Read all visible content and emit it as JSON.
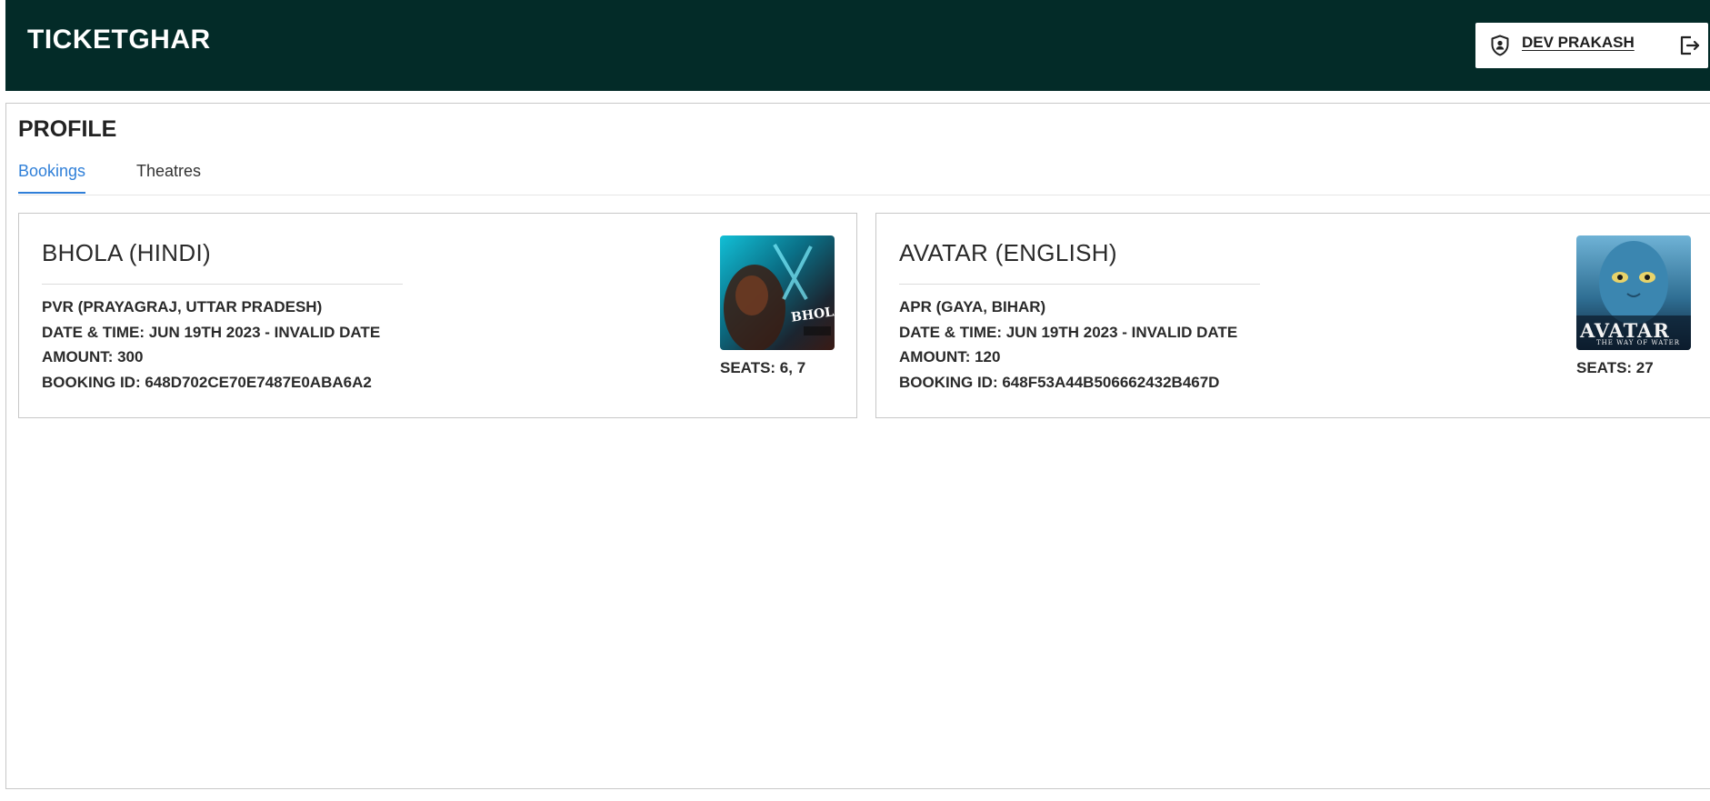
{
  "app": {
    "brand": "TICKETGHAR",
    "user_name": "DEV PRAKASH",
    "icons": {
      "user": "shield-user-icon",
      "logout": "logout-icon"
    },
    "colors": {
      "header_bg": "#032b28",
      "tab_active": "#2f7fd8"
    }
  },
  "page": {
    "title": "PROFILE",
    "tabs": [
      {
        "label": "Bookings",
        "active": true
      },
      {
        "label": "Theatres",
        "active": false
      }
    ]
  },
  "bookings": [
    {
      "movie": "BHOLA (HINDI)",
      "theatre": "PVR (PRAYAGRAJ, UTTAR PRADESH)",
      "datetime": "DATE & TIME: JUN 19TH 2023 - INVALID DATE",
      "amount": "AMOUNT: 300",
      "booking_id": "BOOKING ID: 648D702CE70E7487E0ABA6A2",
      "seats": "SEATS: 6, 7",
      "poster_text": "BHOLAA"
    },
    {
      "movie": "AVATAR (ENGLISH)",
      "theatre": "APR (GAYA, BIHAR)",
      "datetime": "DATE & TIME: JUN 19TH 2023 - INVALID DATE",
      "amount": "AMOUNT: 120",
      "booking_id": "BOOKING ID: 648F53A44B506662432B467D",
      "seats": "SEATS: 27",
      "poster_text": "AVATAR",
      "poster_subtext": "THE WAY OF WATER"
    }
  ]
}
